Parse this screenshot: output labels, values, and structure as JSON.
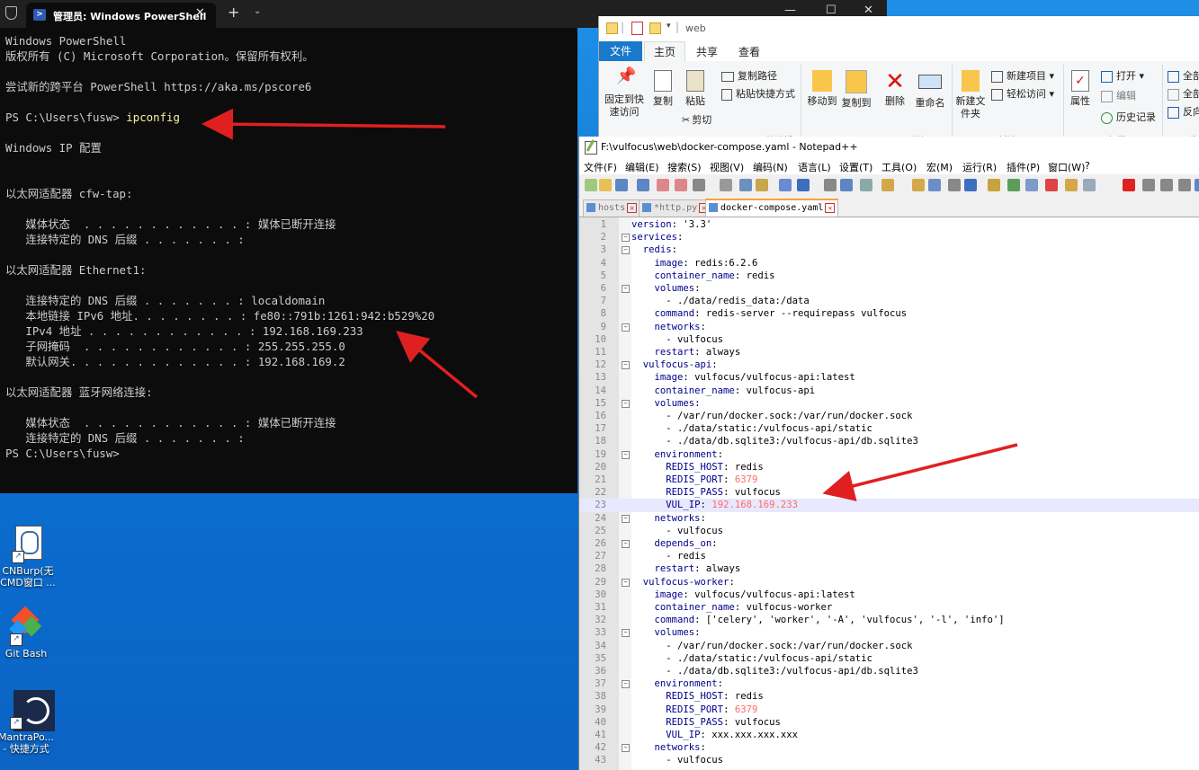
{
  "desktop": {
    "icons": [
      {
        "label": "CNBurp(无CMD窗口 ...",
        "icon": "script-icon"
      },
      {
        "label": "Git Bash",
        "icon": "git-bash-icon"
      },
      {
        "label": "MantraPo... - 快捷方式",
        "icon": "mantra-icon"
      }
    ]
  },
  "terminal": {
    "tab_title": "管理员: Windows PowerShell",
    "lines": [
      "Windows PowerShell",
      "版权所有 (C) Microsoft Corporation。保留所有权利。",
      "",
      "尝试新的跨平台 PowerShell https://aka.ms/pscore6",
      "",
      "PS C:\\Users\\fusw> ",
      "",
      "Windows IP 配置",
      "",
      "",
      "以太网适配器 cfw-tap:",
      "",
      "   媒体状态  . . . . . . . . . . . . : 媒体已断开连接",
      "   连接特定的 DNS 后缀 . . . . . . . :",
      "",
      "以太网适配器 Ethernet1:",
      "",
      "   连接特定的 DNS 后缀 . . . . . . . : localdomain",
      "   本地链接 IPv6 地址. . . . . . . . : fe80::791b:1261:942:b529%20",
      "   IPv4 地址 . . . . . . . . . . . . : 192.168.169.233",
      "   子网掩码  . . . . . . . . . . . . : 255.255.255.0",
      "   默认网关. . . . . . . . . . . . . : 192.168.169.2",
      "",
      "以太网适配器 蓝牙网络连接:",
      "",
      "   媒体状态  . . . . . . . . . . . . : 媒体已断开连接",
      "   连接特定的 DNS 后缀 . . . . . . . :",
      "PS C:\\Users\\fusw>"
    ],
    "command": "ipconfig"
  },
  "explorer": {
    "title": "web",
    "tabs": [
      "文件",
      "主页",
      "共享",
      "查看"
    ],
    "ribbon": {
      "pin": "固定到快速访问",
      "copy": "复制",
      "paste": "粘贴",
      "copy_path": "复制路径",
      "paste_shortcut": "粘贴快捷方式",
      "cut": "剪切",
      "group_clipboard": "剪贴板",
      "move_to": "移动到",
      "copy_to": "复制到",
      "delete": "删除",
      "rename": "重命名",
      "group_organize": "组织",
      "new_folder": "新建文件夹",
      "new_item": "新建项目",
      "easy_access": "轻松访问",
      "group_new": "新建",
      "properties": "属性",
      "open": "打开",
      "edit": "编辑",
      "history": "历史记录",
      "group_open": "打开",
      "select_all": "全部",
      "select_none": "全部",
      "invert": "反向",
      "group_select": "选"
    }
  },
  "notepadpp": {
    "title": "F:\\vulfocus\\web\\docker-compose.yaml - Notepad++",
    "menu": [
      "文件(F)",
      "编辑(E)",
      "搜索(S)",
      "视图(V)",
      "编码(N)",
      "语言(L)",
      "设置(T)",
      "工具(O)",
      "宏(M)",
      "运行(R)",
      "插件(P)",
      "窗口(W)",
      "?"
    ],
    "tabs": [
      "hosts",
      "*http.py",
      "docker-compose.yaml"
    ],
    "current_line": 23,
    "lines": [
      [
        {
          "t": "version",
          "c": "k"
        },
        {
          "t": ": '3.3'"
        }
      ],
      [
        {
          "t": "services",
          "c": "k"
        },
        {
          "t": ":"
        }
      ],
      [
        {
          "t": "  redis",
          "c": "k"
        },
        {
          "t": ":"
        }
      ],
      [
        {
          "t": "    image",
          "c": "k"
        },
        {
          "t": ": redis:6.2.6"
        }
      ],
      [
        {
          "t": "    container_name",
          "c": "k"
        },
        {
          "t": ": redis"
        }
      ],
      [
        {
          "t": "    volumes",
          "c": "k"
        },
        {
          "t": ":"
        }
      ],
      [
        {
          "t": "      - ./data/redis_data:/data"
        }
      ],
      [
        {
          "t": "    command",
          "c": "k"
        },
        {
          "t": ": redis-server --requirepass vulfocus"
        }
      ],
      [
        {
          "t": "    networks",
          "c": "k"
        },
        {
          "t": ":"
        }
      ],
      [
        {
          "t": "      - vulfocus"
        }
      ],
      [
        {
          "t": "    restart",
          "c": "k"
        },
        {
          "t": ": always"
        }
      ],
      [
        {
          "t": "  vulfocus-api",
          "c": "k"
        },
        {
          "t": ":"
        }
      ],
      [
        {
          "t": "    image",
          "c": "k"
        },
        {
          "t": ": vulfocus/vulfocus-api:latest"
        }
      ],
      [
        {
          "t": "    container_name",
          "c": "k"
        },
        {
          "t": ": vulfocus-api"
        }
      ],
      [
        {
          "t": "    volumes",
          "c": "k"
        },
        {
          "t": ":"
        }
      ],
      [
        {
          "t": "      - /var/run/docker.sock:/var/run/docker.sock"
        }
      ],
      [
        {
          "t": "      - ./data/static:/vulfocus-api/static"
        }
      ],
      [
        {
          "t": "      - ./data/db.sqlite3:/vulfocus-api/db.sqlite3"
        }
      ],
      [
        {
          "t": "    environment",
          "c": "k"
        },
        {
          "t": ":"
        }
      ],
      [
        {
          "t": "      REDIS_HOST",
          "c": "k"
        },
        {
          "t": ": redis"
        }
      ],
      [
        {
          "t": "      REDIS_PORT",
          "c": "k"
        },
        {
          "t": ": "
        },
        {
          "t": "6379",
          "c": "n"
        }
      ],
      [
        {
          "t": "      REDIS_PASS",
          "c": "k"
        },
        {
          "t": ": vulfocus"
        }
      ],
      [
        {
          "t": "      VUL_IP",
          "c": "k"
        },
        {
          "t": ": "
        },
        {
          "t": "192.168.169.233",
          "c": "n"
        }
      ],
      [
        {
          "t": "    networks",
          "c": "k"
        },
        {
          "t": ":"
        }
      ],
      [
        {
          "t": "      - vulfocus"
        }
      ],
      [
        {
          "t": "    depends_on",
          "c": "k"
        },
        {
          "t": ":"
        }
      ],
      [
        {
          "t": "      - redis"
        }
      ],
      [
        {
          "t": "    restart",
          "c": "k"
        },
        {
          "t": ": always"
        }
      ],
      [
        {
          "t": "  vulfocus-worker",
          "c": "k"
        },
        {
          "t": ":"
        }
      ],
      [
        {
          "t": "    image",
          "c": "k"
        },
        {
          "t": ": vulfocus/vulfocus-api:latest"
        }
      ],
      [
        {
          "t": "    container_name",
          "c": "k"
        },
        {
          "t": ": vulfocus-worker"
        }
      ],
      [
        {
          "t": "    command",
          "c": "k"
        },
        {
          "t": ": ['celery', 'worker', '-A', 'vulfocus', '-l', 'info']"
        }
      ],
      [
        {
          "t": "    volumes",
          "c": "k"
        },
        {
          "t": ":"
        }
      ],
      [
        {
          "t": "      - /var/run/docker.sock:/var/run/docker.sock"
        }
      ],
      [
        {
          "t": "      - ./data/static:/vulfocus-api/static"
        }
      ],
      [
        {
          "t": "      - ./data/db.sqlite3:/vulfocus-api/db.sqlite3"
        }
      ],
      [
        {
          "t": "    environment",
          "c": "k"
        },
        {
          "t": ":"
        }
      ],
      [
        {
          "t": "      REDIS_HOST",
          "c": "k"
        },
        {
          "t": ": redis"
        }
      ],
      [
        {
          "t": "      REDIS_PORT",
          "c": "k"
        },
        {
          "t": ": "
        },
        {
          "t": "6379",
          "c": "n"
        }
      ],
      [
        {
          "t": "      REDIS_PASS",
          "c": "k"
        },
        {
          "t": ": vulfocus"
        }
      ],
      [
        {
          "t": "      VUL_IP",
          "c": "k"
        },
        {
          "t": ": xxx.xxx.xxx.xxx"
        }
      ],
      [
        {
          "t": "    networks",
          "c": "k"
        },
        {
          "t": ":"
        }
      ],
      [
        {
          "t": "      - vulfocus"
        }
      ]
    ],
    "fold_lines": [
      2,
      3,
      6,
      9,
      12,
      15,
      19,
      24,
      26,
      29,
      33,
      37,
      42
    ]
  },
  "colors": {
    "arrow": "#e02020",
    "terminal_bg": "#0c0c0c",
    "accent": "#1979ca"
  }
}
